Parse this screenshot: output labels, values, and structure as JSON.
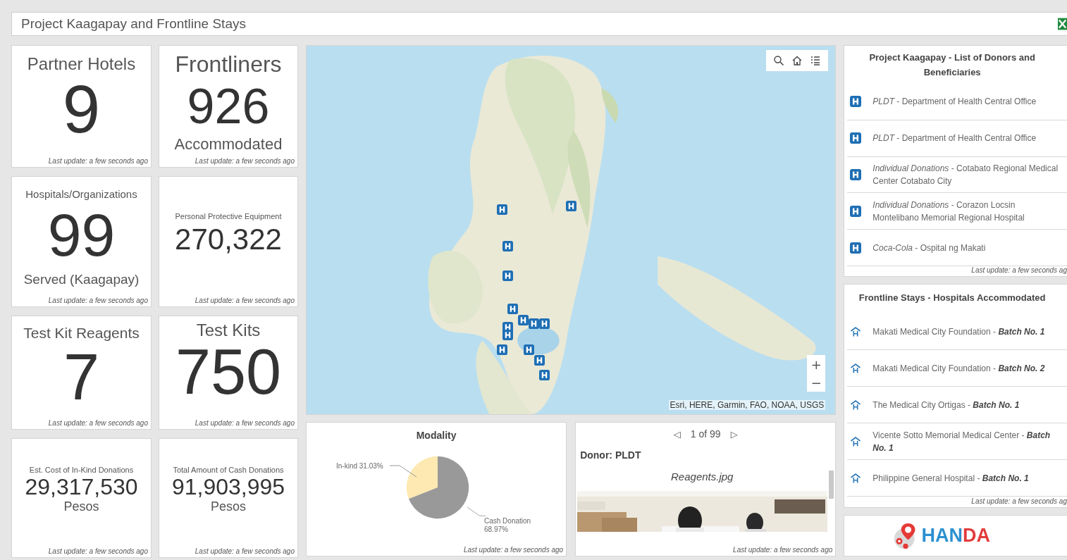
{
  "header": {
    "title": "Project Kaagapay and Frontline Stays"
  },
  "indicators": [
    {
      "top": "Partner Hotels",
      "value": "9",
      "updated": "Last update: a few seconds ago"
    },
    {
      "top": "Frontliners",
      "value": "926",
      "bottom": "Accommodated",
      "updated": "Last update: a few seconds ago"
    },
    {
      "top": "Hospitals/Organizations",
      "value": "99",
      "bottom": "Served (Kaagapay)",
      "updated": "Last update: a few seconds ago"
    },
    {
      "top": "Personal Protective Equipment",
      "value": "270,322",
      "updated": "Last update: a few seconds ago"
    },
    {
      "top": "Test Kit Reagents",
      "value": "7",
      "updated": "Last update: a few seconds ago"
    },
    {
      "top": "Test Kits",
      "value": "750",
      "updated": "Last update: a few seconds ago"
    },
    {
      "top": "Est. Cost of In-Kind Donations",
      "value": "29,317,530",
      "bottom": "Pesos",
      "updated": "Last update: a few seconds ago"
    },
    {
      "top": "Total Amount of Cash Donations",
      "value": "91,903,995",
      "bottom": "Pesos",
      "updated": "Last update: a few seconds ago"
    }
  ],
  "map": {
    "kind": "picture",
    "zoom_in": "+",
    "zoom_out": "−",
    "attribution": "Esri, HERE, Garmin, FAO, NOAA, USGS"
  },
  "modality": {
    "updated": "Last update: a few seconds ago",
    "chart_data": {
      "type": "pie",
      "title": "Modality",
      "values": [
        31.03,
        68.97
      ],
      "value_labels": [
        "In-kind 31.03%",
        "Cash Donation 68.97%"
      ]
    }
  },
  "gallery": {
    "prev": "◁",
    "page": "1 of 99",
    "next": "▷",
    "donor": "Donor: PLDT",
    "caption": "Reagents.jpg",
    "updated": "Last update: a few seconds ago"
  },
  "donors": {
    "title": "Project Kaagapay - List of Donors and Beneficiaries",
    "items": [
      "*PLDT* - Department of Health Central Office",
      "*PLDT* - Department of Health Central Office",
      "*Individual Donations* - Cotabato Regional Medical Center Cotabato City",
      "*Individual Donations* - Corazon Locsin Montelibano Memorial Regional Hospital",
      "*Coca-Cola* - Ospital ng Makati"
    ],
    "updated": "Last update: a few seconds ag"
  },
  "frontline": {
    "title": "Frontline Stays - Hospitals Accommodated",
    "items": [
      "Makati Medical City Foundation  - **Batch No. 1**",
      "Makati Medical City Foundation  - **Batch No. 2**",
      "The Medical City Ortigas  - **Batch No. 1**",
      "Vicente Sotto Memorial Medical Center - **Batch No. 1**",
      "Philippine General Hospital  - **Batch No. 1**"
    ],
    "updated": "Last update: a few seconds ag"
  },
  "logo": {
    "text": "HANDA"
  }
}
